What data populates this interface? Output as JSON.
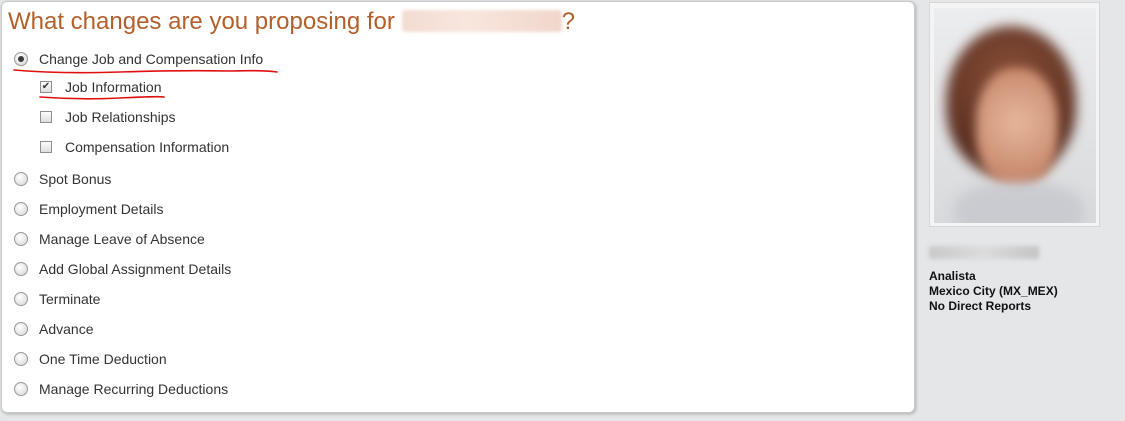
{
  "heading": {
    "prefix": "What changes are you proposing for ",
    "suffix": "?"
  },
  "options": {
    "change_job": "Change Job and Compensation Info",
    "job_information": "Job Information",
    "job_relationships": "Job Relationships",
    "compensation_information": "Compensation Information",
    "spot_bonus": "Spot Bonus",
    "employment_details": "Employment Details",
    "manage_leave": "Manage Leave of Absence",
    "global_assignment": "Add Global Assignment Details",
    "terminate": "Terminate",
    "advance": "Advance",
    "one_time_deduction": "One Time Deduction",
    "recurring_deductions": "Manage Recurring Deductions"
  },
  "state": {
    "selected_option": "change_job",
    "job_information_checked": true,
    "job_relationships_checked": false,
    "compensation_information_checked": false,
    "check_glyph": "✔"
  },
  "profile": {
    "title": "Analista",
    "location": "Mexico City (MX_MEX)",
    "reports": "No Direct Reports"
  },
  "colors": {
    "heading": "#b35f2a",
    "annotation": "#e01010",
    "background": "#e4e6e8"
  }
}
